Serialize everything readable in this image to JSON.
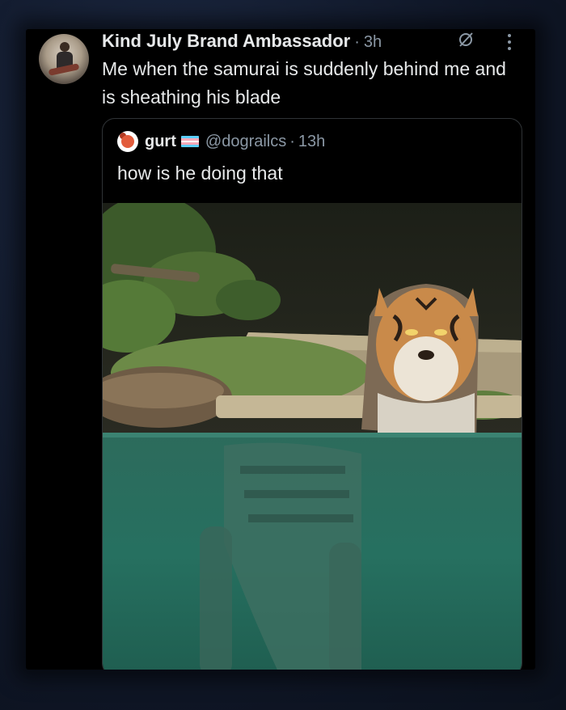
{
  "post": {
    "author_name": "Kind July Brand Ambassador",
    "separator": "·",
    "time": "3h",
    "text": "Me when the samurai is suddenly behind me and is sheathing his blade",
    "icons": {
      "grok": "grok-icon",
      "more": "more-options-icon",
      "avatar": "avatar-image"
    }
  },
  "quoted_post": {
    "author_name": "gurt",
    "handle": "@dograilcs",
    "separator": "·",
    "time": "13h",
    "text": "how is he doing that",
    "flag_colors": [
      "#5bcefa",
      "#f5a9b8",
      "#ffffff",
      "#f5a9b8",
      "#5bcefa"
    ],
    "media": "tiger-in-pool-image"
  },
  "colors": {
    "background": "#000000",
    "text_primary": "#e7e9ea",
    "text_secondary": "#8b98a5",
    "border": "#2f3336"
  }
}
